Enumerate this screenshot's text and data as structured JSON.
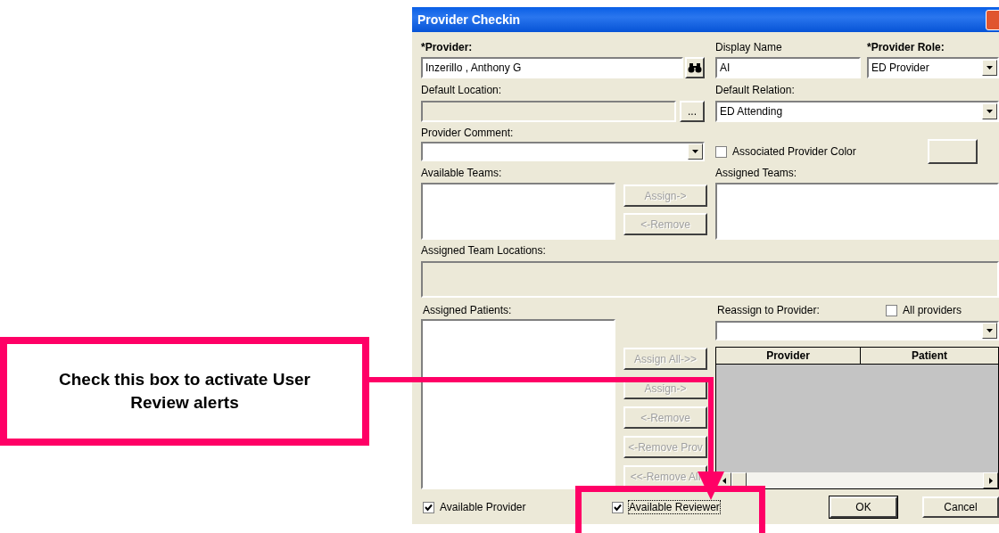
{
  "window": {
    "title": "Provider Checkin"
  },
  "provider": {
    "label": "*Provider:",
    "value": "Inzerillo , Anthony G"
  },
  "display_name": {
    "label": "Display Name",
    "value": "AI"
  },
  "provider_role": {
    "label": "*Provider Role:",
    "value": "ED Provider"
  },
  "default_location": {
    "label": "Default Location:",
    "disabled": true,
    "button": "..."
  },
  "default_relation": {
    "label": "Default Relation:",
    "value": "ED Attending"
  },
  "provider_comment": {
    "label": "Provider Comment:"
  },
  "associated_color": {
    "label": "Associated Provider Color",
    "checked": false
  },
  "available_teams": {
    "label": "Available Teams:"
  },
  "team_buttons": [
    {
      "label": "Assign->",
      "disabled": true
    },
    {
      "label": "<-Remove",
      "disabled": true
    }
  ],
  "assigned_teams": {
    "label": "Assigned Teams:"
  },
  "team_locations": {
    "label": "Assigned Team Locations:"
  },
  "assigned_patients": {
    "label": "Assigned Patients:"
  },
  "reassign": {
    "label": "Reassign to Provider:"
  },
  "all_providers": {
    "label": "All providers",
    "checked": false
  },
  "patient_buttons": [
    {
      "label": "Assign All->>",
      "disabled": true
    },
    {
      "label": "Assign->",
      "disabled": true
    },
    {
      "label": "<-Remove",
      "disabled": true
    },
    {
      "label": "<-Remove Prov",
      "disabled": true
    },
    {
      "label": "<<-Remove All",
      "disabled": true
    }
  ],
  "table": {
    "columns": [
      "Provider",
      "Patient"
    ]
  },
  "options": [
    {
      "label": "Available Provider",
      "checked": true,
      "focused": false
    },
    {
      "label": "Available Reviewer",
      "checked": true,
      "focused": true
    }
  ],
  "buttons": [
    {
      "label": "OK",
      "default": true
    },
    {
      "label": "Cancel",
      "default": false
    }
  ],
  "callout": {
    "text": "Check this box to activate User Review alerts"
  }
}
